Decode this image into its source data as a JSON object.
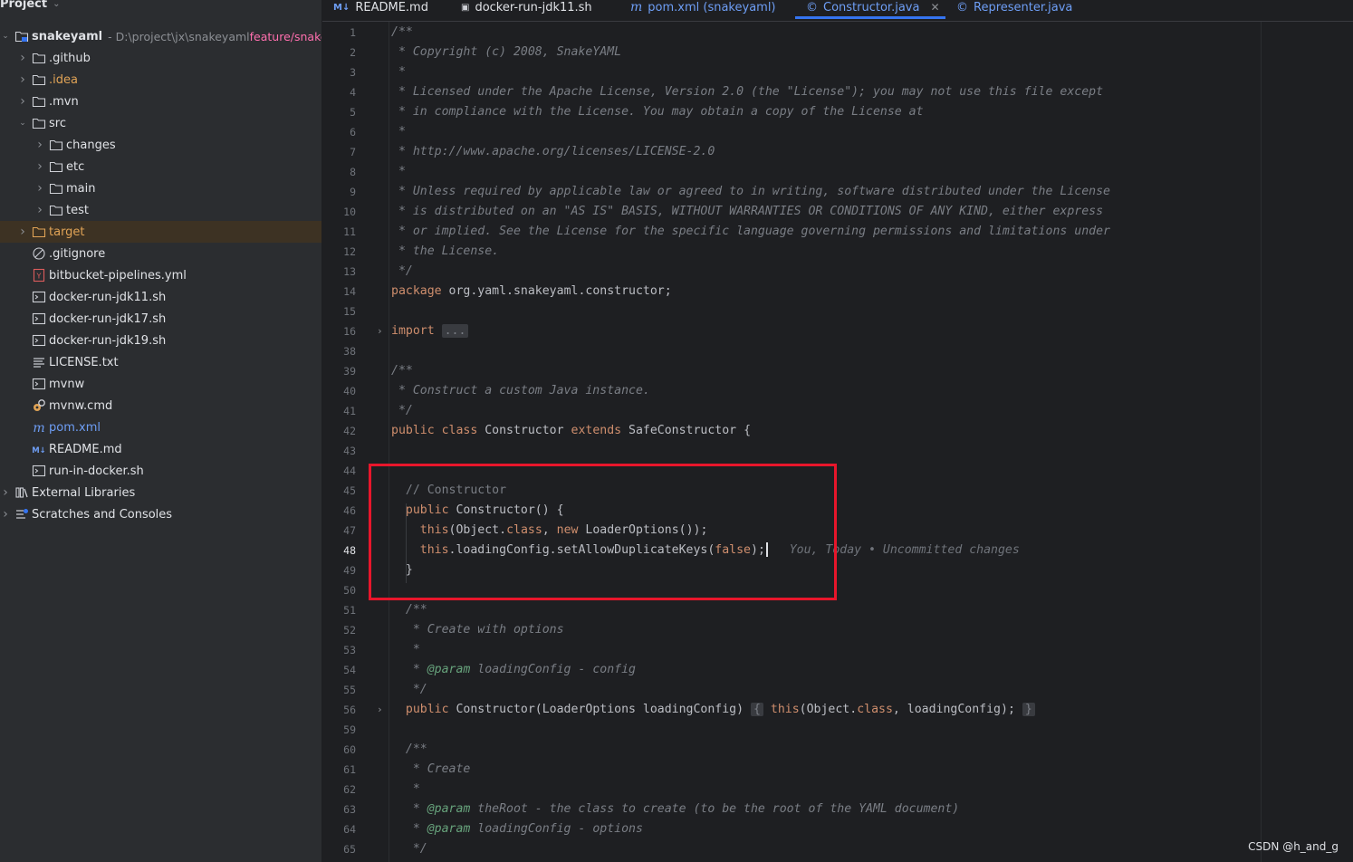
{
  "project_panel": {
    "title": "Project",
    "tree": [
      {
        "label": "snakeyaml",
        "path": "- D:\\project\\jx\\snakeyaml",
        "branch": "feature/snake",
        "indent": 0,
        "arrow": "expanded",
        "icon": "module-folder-icon",
        "bold": true
      },
      {
        "label": ".github",
        "indent": 1,
        "arrow": "collapsed",
        "icon": "folder-icon"
      },
      {
        "label": ".idea",
        "indent": 1,
        "arrow": "collapsed",
        "icon": "folder-icon",
        "color": "orange"
      },
      {
        "label": ".mvn",
        "indent": 1,
        "arrow": "collapsed",
        "icon": "folder-icon"
      },
      {
        "label": "src",
        "indent": 1,
        "arrow": "expanded",
        "icon": "folder-icon"
      },
      {
        "label": "changes",
        "indent": 2,
        "arrow": "collapsed",
        "icon": "folder-icon"
      },
      {
        "label": "etc",
        "indent": 2,
        "arrow": "collapsed",
        "icon": "folder-icon"
      },
      {
        "label": "main",
        "indent": 2,
        "arrow": "collapsed",
        "icon": "folder-icon"
      },
      {
        "label": "test",
        "indent": 2,
        "arrow": "collapsed",
        "icon": "folder-icon"
      },
      {
        "label": "target",
        "indent": 1,
        "arrow": "collapsed",
        "icon": "excluded-folder-icon",
        "color": "orange",
        "selected": true
      },
      {
        "label": ".gitignore",
        "indent": 1,
        "icon": "ignore-file-icon"
      },
      {
        "label": "bitbucket-pipelines.yml",
        "indent": 1,
        "icon": "yaml-file-icon"
      },
      {
        "label": "docker-run-jdk11.sh",
        "indent": 1,
        "icon": "shell-script-icon"
      },
      {
        "label": "docker-run-jdk17.sh",
        "indent": 1,
        "icon": "shell-script-icon"
      },
      {
        "label": "docker-run-jdk19.sh",
        "indent": 1,
        "icon": "shell-script-icon"
      },
      {
        "label": "LICENSE.txt",
        "indent": 1,
        "icon": "text-file-icon"
      },
      {
        "label": "mvnw",
        "indent": 1,
        "icon": "shell-script-icon"
      },
      {
        "label": "mvnw.cmd",
        "indent": 1,
        "icon": "batch-file-icon"
      },
      {
        "label": "pom.xml",
        "indent": 1,
        "icon": "maven-icon",
        "color": "blue"
      },
      {
        "label": "README.md",
        "indent": 1,
        "icon": "markdown-icon"
      },
      {
        "label": "run-in-docker.sh",
        "indent": 1,
        "icon": "shell-script-icon"
      },
      {
        "label": "External Libraries",
        "indent": 0,
        "arrow": "collapsed",
        "icon": "libraries-icon"
      },
      {
        "label": "Scratches and Consoles",
        "indent": 0,
        "arrow": "collapsed",
        "icon": "scratches-icon"
      }
    ]
  },
  "tabs": [
    {
      "label": "README.md",
      "icon": "M↓",
      "icon_name": "markdown-icon"
    },
    {
      "label": "docker-run-jdk11.sh",
      "icon": "▣",
      "icon_name": "shell-script-icon"
    },
    {
      "label": "pom.xml (snakeyaml)",
      "icon": "m",
      "icon_name": "maven-icon",
      "color": "blue"
    },
    {
      "label": "Constructor.java",
      "icon": "©",
      "icon_name": "java-class-icon",
      "active": true,
      "closable": true
    },
    {
      "label": "Representer.java",
      "icon": "©",
      "icon_name": "java-class-icon",
      "color": "blue"
    }
  ],
  "editor": {
    "current_line": 48,
    "lines": [
      {
        "n": "1",
        "tokens": [
          [
            "cm",
            "/**"
          ]
        ]
      },
      {
        "n": "2",
        "tokens": [
          [
            "cm",
            " * Copyright (c) 2008, SnakeYAML"
          ]
        ]
      },
      {
        "n": "3",
        "tokens": [
          [
            "cm",
            " *"
          ]
        ]
      },
      {
        "n": "4",
        "tokens": [
          [
            "cm",
            " * Licensed under the Apache License, Version 2.0 (the \"License\"); you may not use this file except"
          ]
        ]
      },
      {
        "n": "5",
        "tokens": [
          [
            "cm",
            " * in compliance with the License. You may obtain a copy of the License at"
          ]
        ]
      },
      {
        "n": "6",
        "tokens": [
          [
            "cm",
            " *"
          ]
        ]
      },
      {
        "n": "7",
        "tokens": [
          [
            "cm",
            " * http://www.apache.org/licenses/LICENSE-2.0"
          ]
        ]
      },
      {
        "n": "8",
        "tokens": [
          [
            "cm",
            " *"
          ]
        ]
      },
      {
        "n": "9",
        "tokens": [
          [
            "cm",
            " * Unless required by applicable law or agreed to in writing, software distributed under the License"
          ]
        ]
      },
      {
        "n": "10",
        "tokens": [
          [
            "cm",
            " * is distributed on an \"AS IS\" BASIS, WITHOUT WARRANTIES OR CONDITIONS OF ANY KIND, either express"
          ]
        ]
      },
      {
        "n": "11",
        "tokens": [
          [
            "cm",
            " * or implied. See the License for the specific language governing permissions and limitations under"
          ]
        ]
      },
      {
        "n": "12",
        "tokens": [
          [
            "cm",
            " * the License."
          ]
        ]
      },
      {
        "n": "13",
        "tokens": [
          [
            "cm",
            " */"
          ]
        ]
      },
      {
        "n": "14",
        "tokens": [
          [
            "kw",
            "package "
          ],
          [
            "id",
            "org.yaml.snakeyaml.constructor;"
          ]
        ]
      },
      {
        "n": "15",
        "tokens": []
      },
      {
        "n": "16",
        "fold": true,
        "tokens": [
          [
            "kw",
            "import "
          ],
          [
            "folded",
            "..."
          ]
        ]
      },
      {
        "n": "38",
        "tokens": []
      },
      {
        "n": "39",
        "tokens": [
          [
            "cm",
            "/**"
          ]
        ]
      },
      {
        "n": "40",
        "tokens": [
          [
            "cm",
            " * Construct a custom Java instance."
          ]
        ]
      },
      {
        "n": "41",
        "tokens": [
          [
            "cm",
            " */"
          ]
        ]
      },
      {
        "n": "42",
        "tokens": [
          [
            "kw",
            "public class "
          ],
          [
            "id",
            "Constructor "
          ],
          [
            "kw",
            "extends "
          ],
          [
            "id",
            "SafeConstructor {"
          ]
        ]
      },
      {
        "n": "43",
        "tokens": []
      },
      {
        "n": "44",
        "tokens": []
      },
      {
        "n": "45",
        "tokens": [
          [
            "id",
            "  "
          ],
          [
            "cmp",
            "// Constructor"
          ]
        ]
      },
      {
        "n": "46",
        "tokens": [
          [
            "id",
            "  "
          ],
          [
            "kw",
            "public "
          ],
          [
            "id",
            "Constructor() {"
          ]
        ]
      },
      {
        "n": "47",
        "tokens": [
          [
            "id",
            "    "
          ],
          [
            "kw",
            "this"
          ],
          [
            "id",
            "(Object."
          ],
          [
            "kw",
            "class"
          ],
          [
            "id",
            ", "
          ],
          [
            "kw",
            "new "
          ],
          [
            "id",
            "LoaderOptions());"
          ]
        ]
      },
      {
        "n": "48",
        "tokens": [
          [
            "id",
            "    "
          ],
          [
            "kw",
            "this"
          ],
          [
            "id",
            ".loadingConfig.setAllowDuplicateKeys("
          ],
          [
            "kw",
            "false"
          ],
          [
            "id",
            ");"
          ],
          [
            "caret",
            ""
          ],
          [
            "inlay",
            "   You, Today • Uncommitted changes"
          ]
        ]
      },
      {
        "n": "49",
        "tokens": [
          [
            "id",
            "  }"
          ]
        ]
      },
      {
        "n": "50",
        "tokens": []
      },
      {
        "n": "51",
        "tokens": [
          [
            "cm",
            "  /**"
          ]
        ]
      },
      {
        "n": "52",
        "tokens": [
          [
            "cm",
            "   * Create with options"
          ]
        ]
      },
      {
        "n": "53",
        "tokens": [
          [
            "cm",
            "   *"
          ]
        ]
      },
      {
        "n": "54",
        "tokens": [
          [
            "cm",
            "   * "
          ],
          [
            "tag",
            "@param"
          ],
          [
            "cm",
            " loadingConfig - config"
          ]
        ]
      },
      {
        "n": "55",
        "tokens": [
          [
            "cm",
            "   */"
          ]
        ]
      },
      {
        "n": "56",
        "fold": true,
        "tokens": [
          [
            "id",
            "  "
          ],
          [
            "kw",
            "public "
          ],
          [
            "id",
            "Constructor(LoaderOptions loadingConfig) "
          ],
          [
            "folded",
            "{"
          ],
          [
            "id",
            " "
          ],
          [
            "kw",
            "this"
          ],
          [
            "id",
            "(Object."
          ],
          [
            "kw",
            "class"
          ],
          [
            "id",
            ", loadingConfig); "
          ],
          [
            "folded",
            "}"
          ]
        ]
      },
      {
        "n": "59",
        "tokens": []
      },
      {
        "n": "60",
        "tokens": [
          [
            "cm",
            "  /**"
          ]
        ]
      },
      {
        "n": "61",
        "tokens": [
          [
            "cm",
            "   * Create"
          ]
        ]
      },
      {
        "n": "62",
        "tokens": [
          [
            "cm",
            "   *"
          ]
        ]
      },
      {
        "n": "63",
        "tokens": [
          [
            "cm",
            "   * "
          ],
          [
            "tag",
            "@param"
          ],
          [
            "cm",
            " theRoot - the class to create (to be the root of the YAML document)"
          ]
        ]
      },
      {
        "n": "64",
        "tokens": [
          [
            "cm",
            "   * "
          ],
          [
            "tag",
            "@param"
          ],
          [
            "cm",
            " loadingConfig - options"
          ]
        ]
      },
      {
        "n": "65",
        "tokens": [
          [
            "cm",
            "   */"
          ]
        ]
      }
    ]
  },
  "watermark": "CSDN @h_and_g",
  "colors": {
    "accent": "#3574f0",
    "highlight_box": "#e8162b",
    "keyword": "#cf8e6d",
    "comment": "#7a7e85",
    "selected_row": "#3d3223"
  }
}
